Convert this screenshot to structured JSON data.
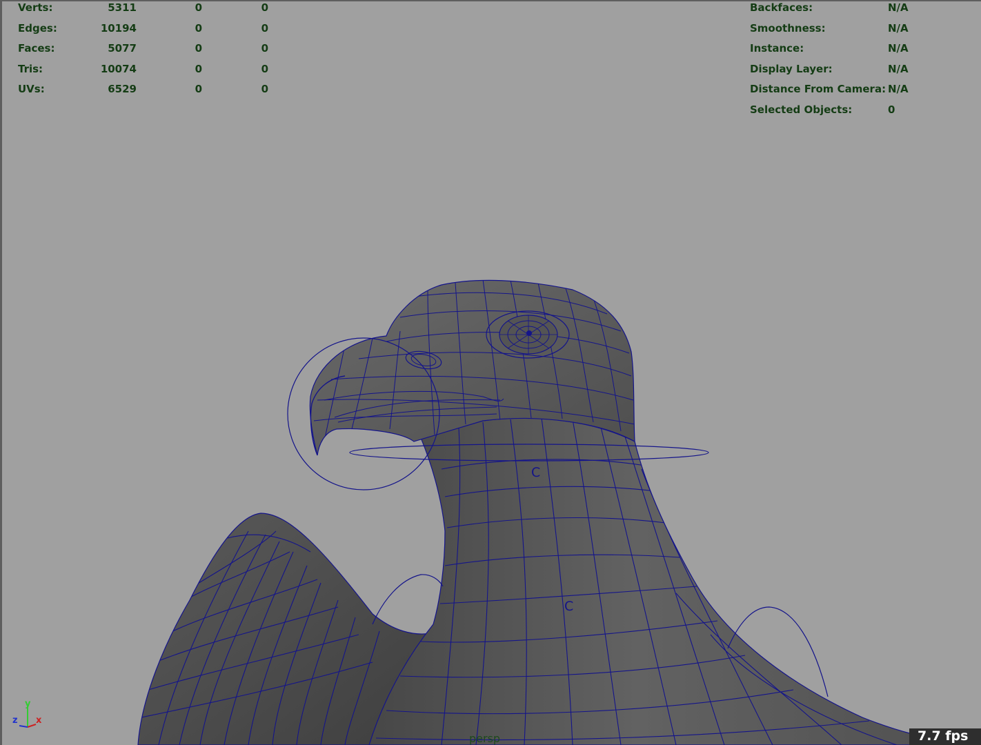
{
  "viewport": {
    "camera": "persp",
    "fps": "7.7 fps",
    "axis_labels": {
      "y": "y",
      "z": "z",
      "x": "x"
    },
    "poly_count": {
      "rows": [
        {
          "label": "Verts:",
          "values": [
            "5311",
            "0",
            "0"
          ]
        },
        {
          "label": "Edges:",
          "values": [
            "10194",
            "0",
            "0"
          ]
        },
        {
          "label": "Faces:",
          "values": [
            "5077",
            "0",
            "0"
          ]
        },
        {
          "label": "Tris:",
          "values": [
            "10074",
            "0",
            "0"
          ]
        },
        {
          "label": "UVs:",
          "values": [
            "6529",
            "0",
            "0"
          ]
        }
      ]
    },
    "object_details": {
      "rows": [
        {
          "label": "Backfaces:",
          "value": "N/A"
        },
        {
          "label": "Smoothness:",
          "value": "N/A"
        },
        {
          "label": "Instance:",
          "value": "N/A"
        },
        {
          "label": "Display Layer:",
          "value": "N/A"
        },
        {
          "label": "Distance From Camera:",
          "value": "N/A"
        },
        {
          "label": "Selected Objects:",
          "value": "0"
        }
      ]
    },
    "control_labels": {
      "neck_upper": "C",
      "neck_lower": "C"
    },
    "colors": {
      "background": "#a0a0a0",
      "hud_text": "#143c14",
      "wireframe": "#14148a",
      "mesh_fill": "#5d5d5d"
    }
  }
}
